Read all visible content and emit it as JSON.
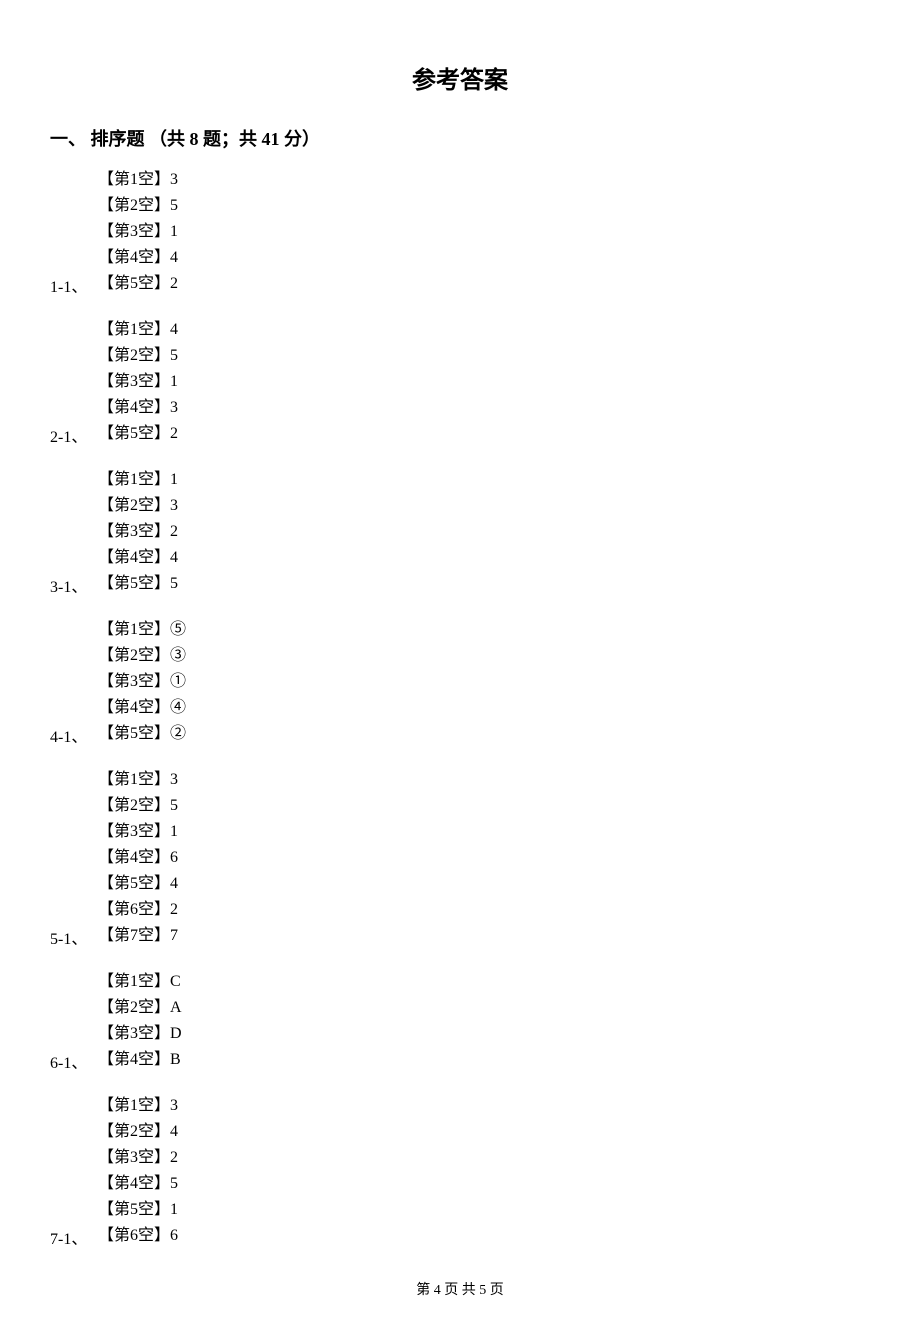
{
  "title": "参考答案",
  "section": {
    "number": "一、",
    "label": "排序题",
    "info": "（共 8 题；共 41 分）"
  },
  "questions": [
    {
      "num": "1-1、",
      "answers": [
        {
          "label": "【第1空】",
          "value": "3"
        },
        {
          "label": "【第2空】",
          "value": "5"
        },
        {
          "label": "【第3空】",
          "value": "1"
        },
        {
          "label": "【第4空】",
          "value": "4"
        },
        {
          "label": "【第5空】",
          "value": "2"
        }
      ]
    },
    {
      "num": "2-1、",
      "answers": [
        {
          "label": "【第1空】",
          "value": "4"
        },
        {
          "label": "【第2空】",
          "value": "5"
        },
        {
          "label": "【第3空】",
          "value": "1"
        },
        {
          "label": "【第4空】",
          "value": "3"
        },
        {
          "label": "【第5空】",
          "value": "2"
        }
      ]
    },
    {
      "num": "3-1、",
      "answers": [
        {
          "label": "【第1空】",
          "value": "1"
        },
        {
          "label": "【第2空】",
          "value": "3"
        },
        {
          "label": "【第3空】",
          "value": "2"
        },
        {
          "label": "【第4空】",
          "value": "4"
        },
        {
          "label": "【第5空】",
          "value": "5"
        }
      ]
    },
    {
      "num": "4-1、",
      "answers": [
        {
          "label": "【第1空】",
          "value": "⑤"
        },
        {
          "label": "【第2空】",
          "value": "③"
        },
        {
          "label": "【第3空】",
          "value": "①"
        },
        {
          "label": "【第4空】",
          "value": "④"
        },
        {
          "label": "【第5空】",
          "value": "②"
        }
      ]
    },
    {
      "num": "5-1、",
      "answers": [
        {
          "label": "【第1空】",
          "value": "3"
        },
        {
          "label": "【第2空】",
          "value": "5"
        },
        {
          "label": "【第3空】",
          "value": "1"
        },
        {
          "label": "【第4空】",
          "value": "6"
        },
        {
          "label": "【第5空】",
          "value": "4"
        },
        {
          "label": "【第6空】",
          "value": "2"
        },
        {
          "label": "【第7空】",
          "value": "7"
        }
      ]
    },
    {
      "num": "6-1、",
      "answers": [
        {
          "label": "【第1空】",
          "value": "C"
        },
        {
          "label": "【第2空】",
          "value": "A"
        },
        {
          "label": "【第3空】",
          "value": "D"
        },
        {
          "label": "【第4空】",
          "value": "B"
        }
      ]
    },
    {
      "num": "7-1、",
      "answers": [
        {
          "label": "【第1空】",
          "value": "3"
        },
        {
          "label": "【第2空】",
          "value": "4"
        },
        {
          "label": "【第3空】",
          "value": "2"
        },
        {
          "label": "【第4空】",
          "value": "5"
        },
        {
          "label": "【第5空】",
          "value": "1"
        },
        {
          "label": "【第6空】",
          "value": "6"
        }
      ]
    }
  ],
  "footer": "第 4 页 共 5 页"
}
